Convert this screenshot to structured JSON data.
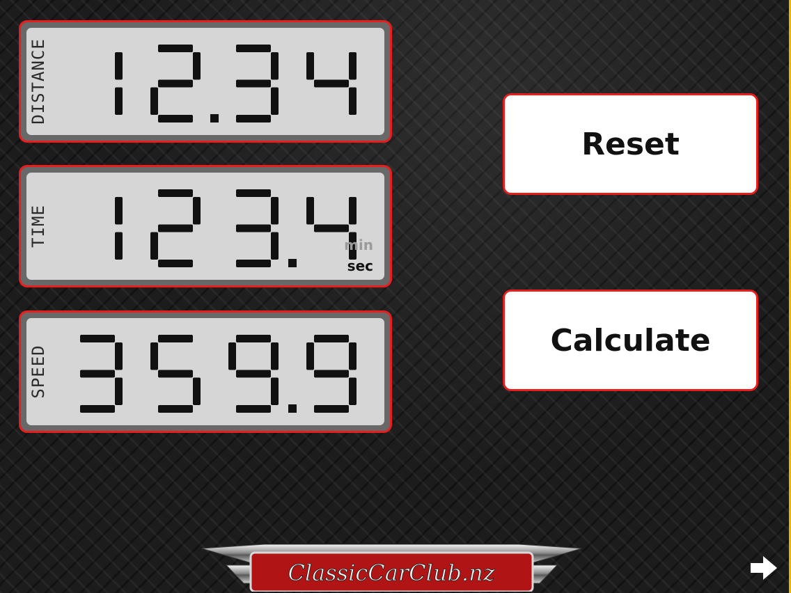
{
  "displays": {
    "distance": {
      "label": "DISTANCE",
      "value": "12.34"
    },
    "time": {
      "label": "TIME",
      "value": "123.4",
      "unit_inactive": "min",
      "unit_active": "sec"
    },
    "speed": {
      "label": "SPEED",
      "value": "359.9"
    }
  },
  "buttons": {
    "reset": "Reset",
    "calculate": "Calculate"
  },
  "logo": {
    "text": "ClassicCarClub.nz"
  },
  "icons": {
    "next": "right-arrow-icon"
  },
  "colors": {
    "accent": "#e81d1d",
    "lcd_background": "#d6d6d6",
    "lcd_bezel": "#686868",
    "lcd_segment": "#111111"
  }
}
